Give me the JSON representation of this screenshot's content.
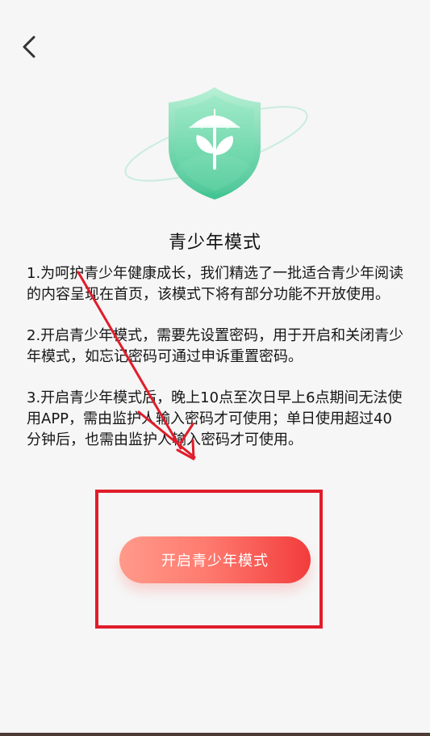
{
  "icons": {
    "back": "back-chevron-icon",
    "shield": "shield-umbrella-sprout-icon"
  },
  "page": {
    "title": "青少年模式",
    "description": [
      "1.为呵护青少年健康成长，我们精选了一批适合青少年阅读的内容呈现在首页，该模式下将有部分功能不开放使用。",
      "2.开启青少年模式，需要先设置密码，用于开启和关闭青少年模式，如忘记密码可通过申诉重置密码。",
      "3.开启青少年模式后，晚上10点至次日早上6点期间无法使用APP，需由监护人输入密码才可使用；单日使用超过40分钟后，也需由监护人输入密码才可使用。"
    ],
    "button_label": "开启青少年模式"
  },
  "colors": {
    "background": "#f6f6f6",
    "shield_start": "#b9f0d6",
    "shield_end": "#3fc390",
    "button_start": "#ff9a8a",
    "button_end": "#f23c3c",
    "annotation_red": "#e01d2b"
  }
}
